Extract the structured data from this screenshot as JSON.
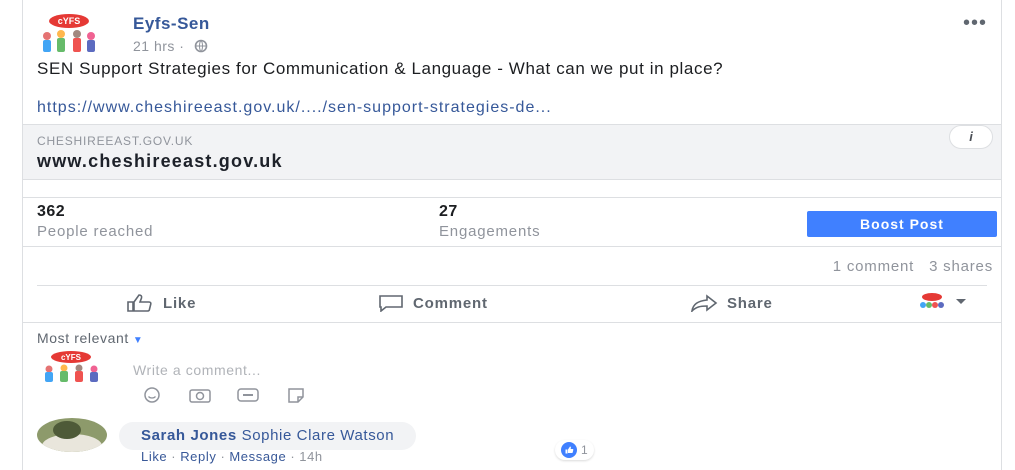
{
  "post": {
    "page_name": "Eyfs-Sen",
    "time": "21 hrs ·",
    "text": "SEN Support Strategies for Communication & Language - What can we put in place?",
    "link": "https://www.cheshireeast.gov.uk/..../sen-support-strategies-de...",
    "more_icon": "•••"
  },
  "preview": {
    "domain": "CHESHIREEAST.GOV.UK",
    "title": "www.cheshireeast.gov.uk",
    "info_label": "i"
  },
  "stats": {
    "reached_value": "362",
    "reached_label": "People reached",
    "engagements_value": "27",
    "engagements_label": "Engagements",
    "boost_label": "Boost Post"
  },
  "counts": {
    "comments": "1 comment",
    "shares": "3 shares"
  },
  "actions": {
    "like": "Like",
    "comment": "Comment",
    "share": "Share"
  },
  "comments": {
    "sort_label": "Most relevant",
    "input_placeholder": "Write a comment...",
    "items": [
      {
        "author": "Sarah Jones",
        "text": "Sophie Clare Watson",
        "like": "Like",
        "reply": "Reply",
        "message": "Message",
        "time": "14h",
        "reaction_count": "1"
      }
    ]
  },
  "icons": {
    "globe": "globe-icon",
    "like": "thumbs-up-icon",
    "comment": "speech-bubble-icon",
    "share": "share-arrow-icon",
    "emoji": "emoji-icon",
    "camera": "camera-icon",
    "gif": "gif-icon",
    "sticker": "sticker-icon"
  },
  "colors": {
    "link": "#365899",
    "boost": "#4080ff",
    "muted": "#90949c"
  }
}
